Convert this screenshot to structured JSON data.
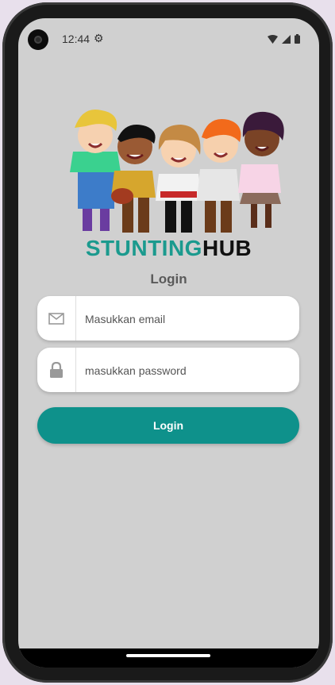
{
  "status_bar": {
    "time": "12:44",
    "settings_icon": "gear-icon"
  },
  "brand": {
    "part1": "STUNTING",
    "part2": "HUB",
    "color1": "#1b9a8e",
    "color2": "#111111"
  },
  "login_title": "Login",
  "email_field": {
    "placeholder": "Masukkan email",
    "icon": "mail-icon"
  },
  "password_field": {
    "placeholder": "masukkan password",
    "icon": "lock-icon"
  },
  "login_button": {
    "label": "Login",
    "color": "#0e918b"
  }
}
